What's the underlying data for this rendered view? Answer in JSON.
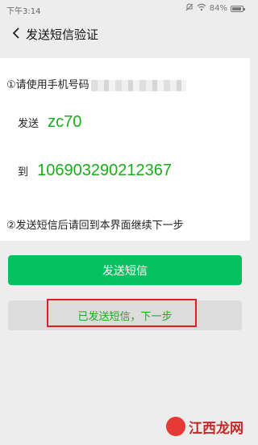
{
  "status_bar": {
    "time": "下午3:14",
    "battery_text": "84%",
    "icons": [
      "mute-icon",
      "wifi-icon",
      "battery-icon"
    ]
  },
  "nav": {
    "title": "发送短信验证"
  },
  "instructions": {
    "step1_prefix": "①请使用手机号码",
    "send_label": "发送",
    "send_code": "zc70",
    "to_label": "到",
    "to_number": "106903290212367",
    "step2": "②发送短信后请回到本界面继续下一步"
  },
  "buttons": {
    "send_sms": "发送短信",
    "sent_next": "已发送短信，下一步"
  },
  "watermark": {
    "text": "江西龙网"
  },
  "colors": {
    "green": "#1aad19",
    "button_green": "#07c160",
    "highlight_red": "#e02020"
  }
}
